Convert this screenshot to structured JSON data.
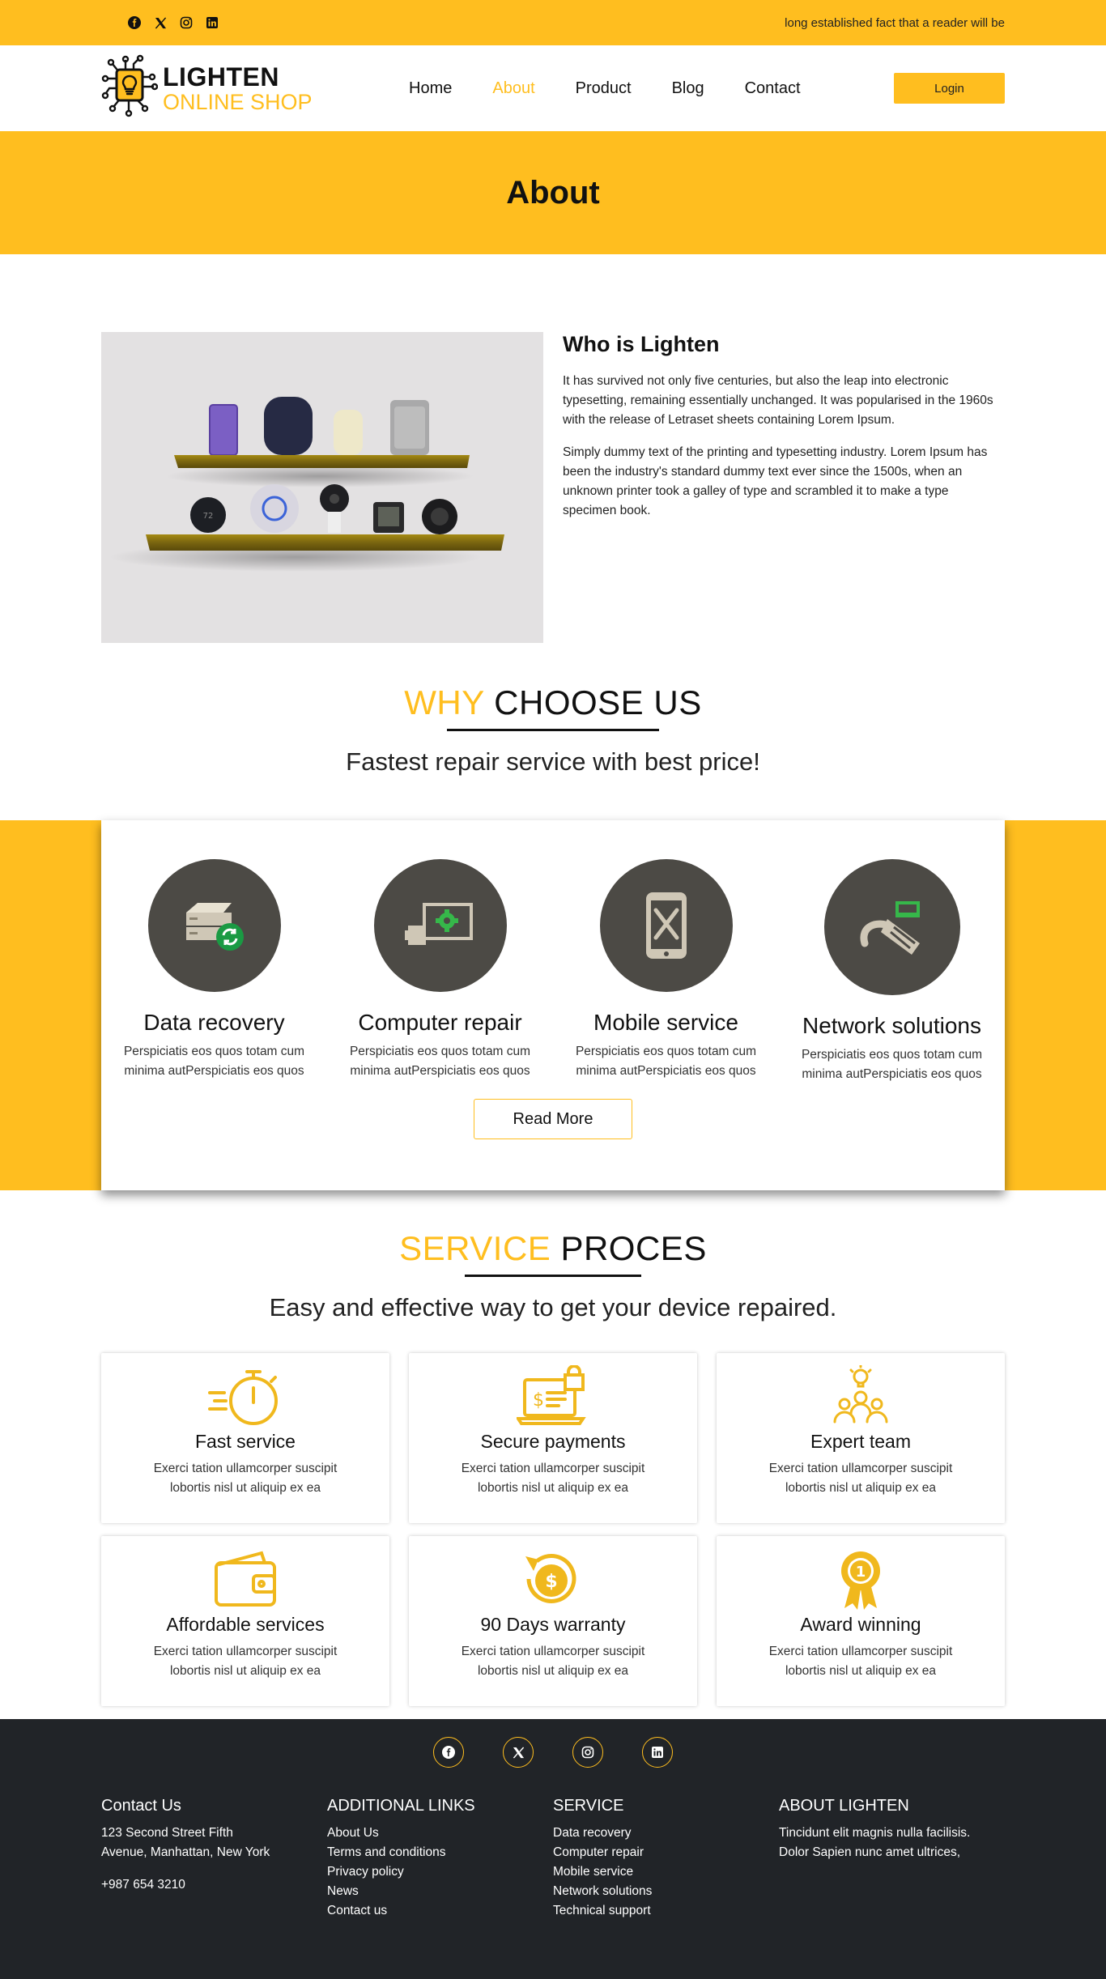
{
  "topbar": {
    "social": [
      "facebook-icon",
      "x-twitter-icon",
      "instagram-icon",
      "linkedin-icon"
    ],
    "marquee": "long established fact that a reader will be"
  },
  "brand": {
    "top": "LIGHTEN",
    "bottom": "ONLINE SHOP"
  },
  "nav": [
    "Home",
    "About",
    "Product",
    "Blog",
    "Contact"
  ],
  "nav_active": "About",
  "login_label": "Login",
  "hero_title": "About",
  "about": {
    "heading": "Who is Lighten",
    "p1": "It has survived not only five centuries, but also the leap into electronic typesetting, remaining essentially unchanged. It was popularised in the 1960s with the release of Letraset sheets containing Lorem Ipsum.",
    "p2": "Simply dummy text of the printing and typesetting industry. Lorem Ipsum has been the industry's standard dummy text ever since the 1500s, when an unknown printer took a galley of type and scrambled it to make a type specimen book."
  },
  "why": {
    "title_accent": "WHY",
    "title_rest": " CHOOSE US",
    "subtitle": "Fastest repair service with best price!",
    "items": [
      {
        "title": "Data recovery",
        "text": "Perspiciatis eos quos totam cum minima autPerspiciatis eos quos"
      },
      {
        "title": "Computer repair",
        "text": "Perspiciatis eos quos totam cum minima autPerspiciatis eos quos"
      },
      {
        "title": "Mobile service",
        "text": "Perspiciatis eos quos totam cum minima autPerspiciatis eos quos"
      },
      {
        "title": "Network solutions",
        "text": "Perspiciatis eos quos totam cum minima autPerspiciatis eos quos"
      }
    ],
    "read_more": "Read More"
  },
  "process": {
    "title_accent": "SERVICE",
    "title_rest": " PROCES",
    "subtitle": "Easy and effective way to get your device repaired.",
    "items": [
      {
        "title": "Fast service",
        "text": "Exerci tation ullamcorper suscipit lobortis nisl ut aliquip ex ea"
      },
      {
        "title": "Secure payments",
        "text": "Exerci tation ullamcorper suscipit lobortis nisl ut aliquip ex ea"
      },
      {
        "title": "Expert team",
        "text": "Exerci tation ullamcorper suscipit lobortis nisl ut aliquip ex ea"
      },
      {
        "title": "Affordable services",
        "text": "Exerci tation ullamcorper suscipit lobortis nisl ut aliquip ex ea"
      },
      {
        "title": "90 Days warranty",
        "text": "Exerci tation ullamcorper suscipit lobortis nisl ut aliquip ex ea"
      },
      {
        "title": "Award winning",
        "text": "Exerci tation ullamcorper suscipit lobortis nisl ut aliquip ex ea"
      }
    ]
  },
  "footer": {
    "contact": {
      "heading": "Contact Us",
      "address": "123 Second Street Fifth Avenue, Manhattan, New York",
      "phone": "+987 654 3210"
    },
    "links": {
      "heading": "ADDITIONAL LINKS",
      "items": [
        "About Us",
        "Terms and conditions",
        "Privacy policy",
        "News",
        "Contact us"
      ]
    },
    "service": {
      "heading": "SERVICE",
      "items": [
        "Data recovery",
        "Computer repair",
        "Mobile service",
        "Network solutions",
        "Technical support"
      ]
    },
    "about": {
      "heading": "ABOUT LIGHTEN",
      "text": "Tincidunt elit magnis nulla facilisis. Dolor Sapien nunc amet ultrices,"
    }
  },
  "colors": {
    "accent": "#ffbe1f",
    "dark": "#212428",
    "icon_bg": "#4c4a45"
  }
}
